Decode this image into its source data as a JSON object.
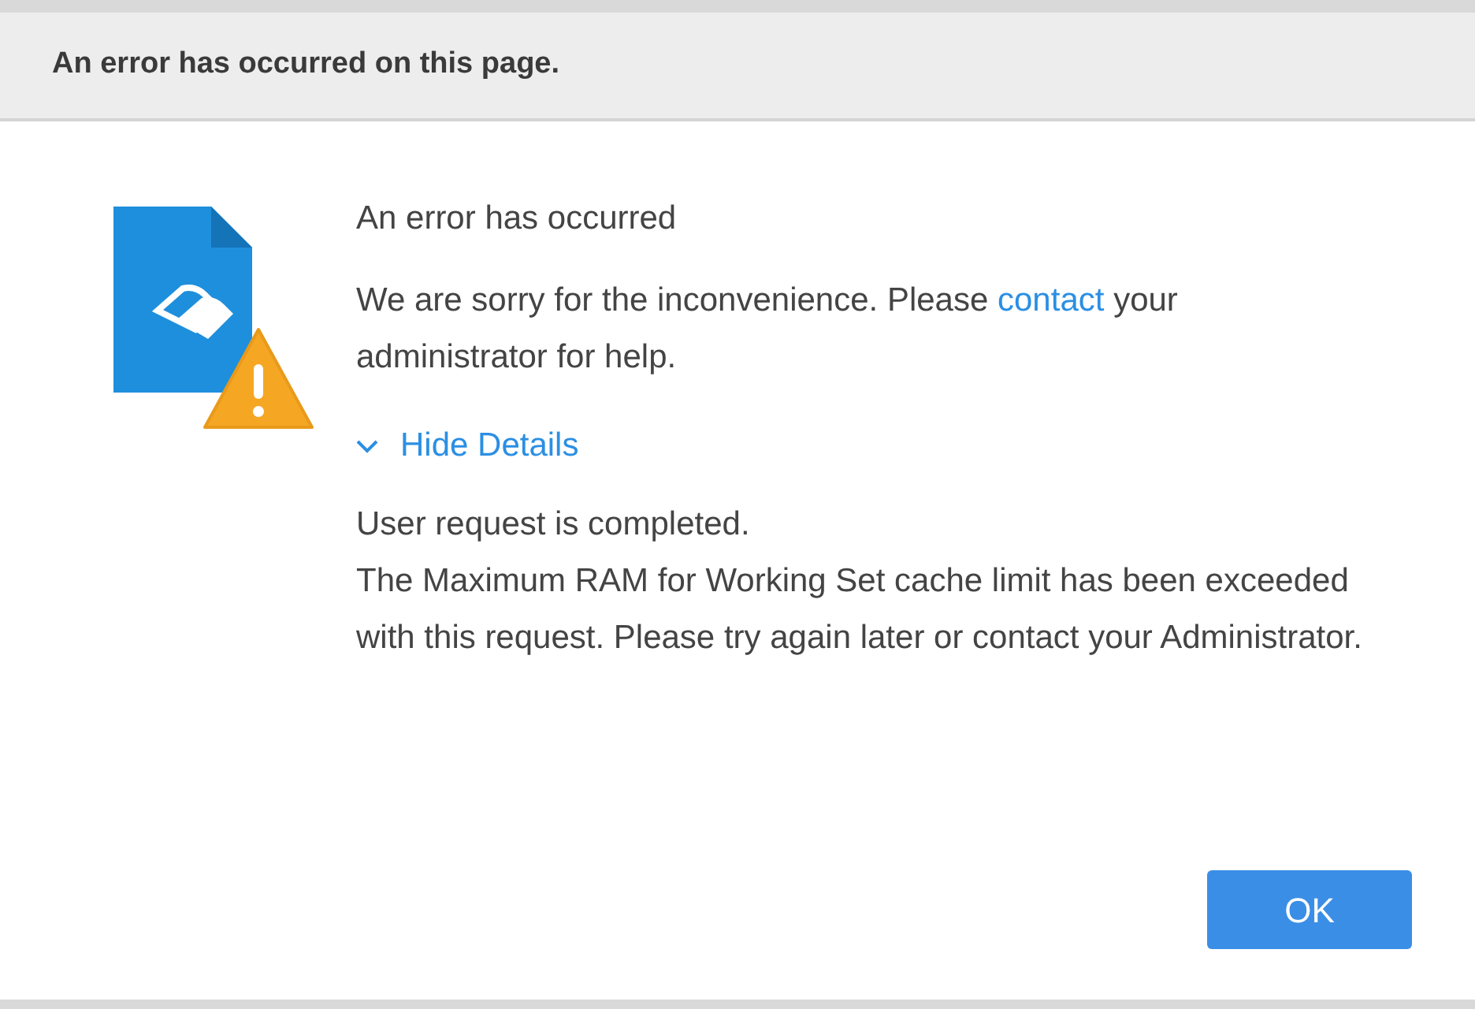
{
  "dialog": {
    "title": "An error has occurred on this page."
  },
  "message": {
    "heading": "An error has occurred",
    "text_before": "We are sorry for the inconvenience. Please",
    "link": "contact",
    "text_after": "your administrator for help."
  },
  "details_toggle": {
    "label": "Hide Details",
    "expanded": true
  },
  "details": [
    "User request is completed.",
    "The Maximum RAM for Working Set cache limit has been exceeded with this request. Please try again later or contact your Administrator."
  ],
  "buttons": [
    "OK"
  ]
}
